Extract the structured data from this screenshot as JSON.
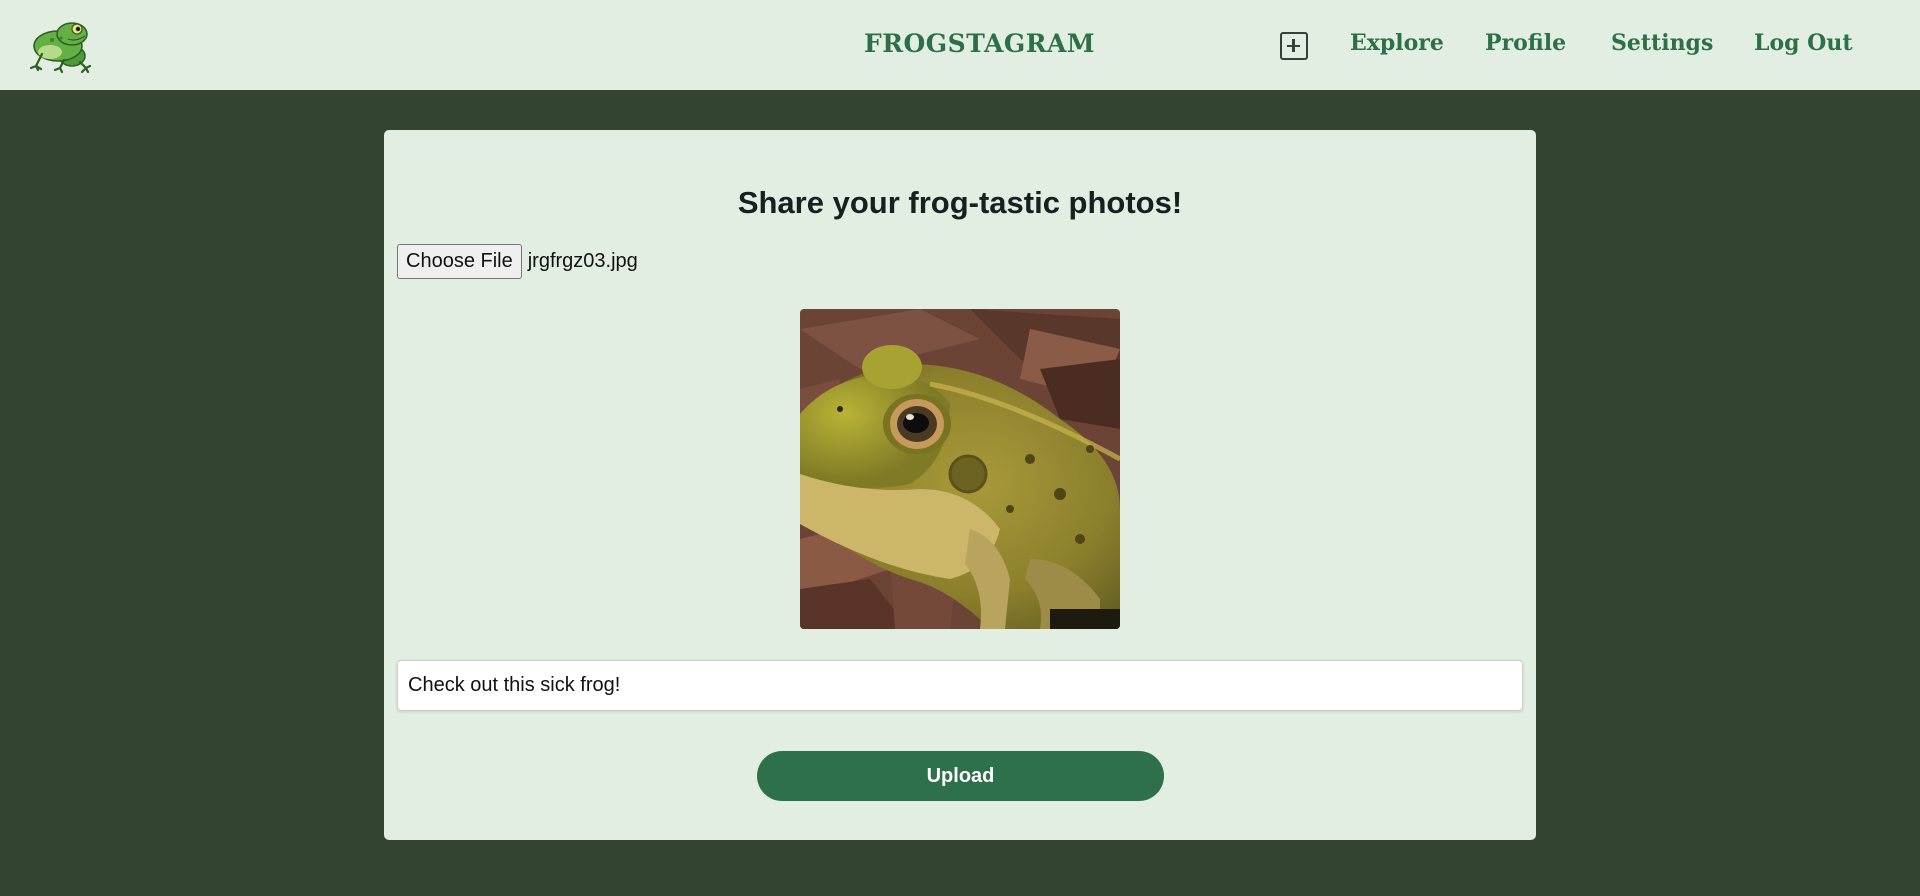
{
  "navbar": {
    "logo_icon": "frog-logo-icon",
    "brand": "FROGSTAGRAM",
    "add_icon": "plus-square-icon",
    "links": [
      "Explore",
      "Profile",
      "Settings",
      "Log Out"
    ]
  },
  "upload_form": {
    "title": "Share your frog-tastic photos!",
    "choose_file_label": "Choose File",
    "file_name": "jrgfrgz03.jpg",
    "preview_image": "frog-photo-preview",
    "caption_value": "Check out this sick frog!",
    "upload_label": "Upload"
  },
  "colors": {
    "page_background": "#334530",
    "navbar_background": "#e3eee2",
    "brand_green": "#2d7048",
    "button_green": "#2e704c"
  }
}
